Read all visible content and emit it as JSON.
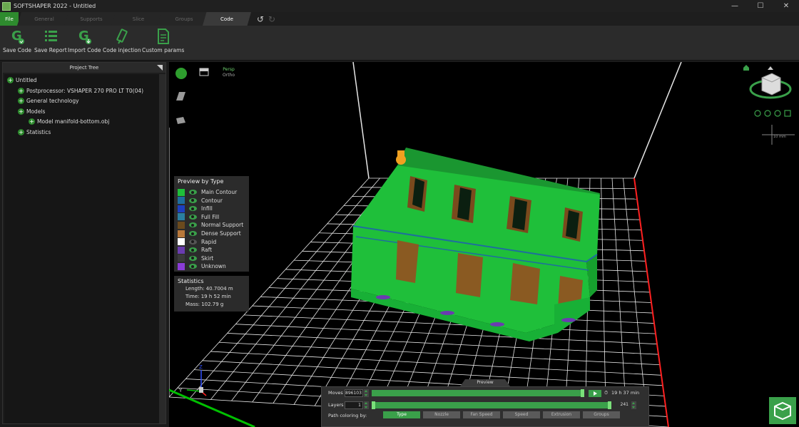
{
  "app": {
    "title": "SOFTSHAPER 2022 - Untitled",
    "window_controls": [
      "—",
      "☐",
      "✕"
    ]
  },
  "tabs": [
    {
      "label": "File",
      "state": "file"
    },
    {
      "label": "General",
      "state": "inactive"
    },
    {
      "label": "Supports",
      "state": "inactive"
    },
    {
      "label": "Slice",
      "state": "inactive"
    },
    {
      "label": "Groups",
      "state": "inactive"
    },
    {
      "label": "Code",
      "state": "active"
    }
  ],
  "toolbar": {
    "save_code": "Save Code",
    "save_report": "Save Report",
    "import_code": "Import Code",
    "code_injection": "Code injection",
    "custom_params": "Custom params"
  },
  "tree": {
    "title": "Project Tree",
    "nodes": [
      {
        "label": "Untitled"
      },
      {
        "label": "Postprocessor: VSHAPER 270 PRO LT T0(04)"
      },
      {
        "label": "General technology"
      },
      {
        "label": "Models"
      },
      {
        "label": "Model manifold-bottom.obj"
      },
      {
        "label": "Statistics"
      }
    ]
  },
  "viewport": {
    "persp": "Persp",
    "ortho": "Ortho",
    "scale_label": "10 mm"
  },
  "legend": {
    "title": "Preview by Type",
    "items": [
      {
        "label": "Main Contour",
        "color": "#1fbf3a",
        "visible": true
      },
      {
        "label": "Contour",
        "color": "#1e6e9e",
        "visible": true
      },
      {
        "label": "Infill",
        "color": "#1d3fc0",
        "visible": true
      },
      {
        "label": "Full Fill",
        "color": "#2a7fa0",
        "visible": true
      },
      {
        "label": "Normal Support",
        "color": "#6b4a1d",
        "visible": true
      },
      {
        "label": "Dense Support",
        "color": "#b8783a",
        "visible": true
      },
      {
        "label": "Rapid",
        "color": "#ffffff",
        "visible": false
      },
      {
        "label": "Raft",
        "color": "#6a3cb0",
        "visible": true
      },
      {
        "label": "Skirt",
        "color": "#3a3a3a",
        "visible": true
      },
      {
        "label": "Unknown",
        "color": "#8a3cd6",
        "visible": true
      }
    ]
  },
  "stats": {
    "title": "Statistics",
    "length": "Length: 40.7004 m",
    "time": "Time: 19 h 52 min",
    "mass": "Mass: 102.79 g"
  },
  "preview": {
    "tab": "Preview",
    "moves_label": "Moves",
    "moves_value": "896103",
    "moves_progress": 1.0,
    "time": "19 h 37 min",
    "layers_label": "Layers",
    "layers_from": "1",
    "layers_to": "241",
    "coloring_label": "Path coloring by:",
    "coloring_options": [
      "Type",
      "Nozzle",
      "Fan Speed",
      "Speed",
      "Extrusion",
      "Groups"
    ],
    "coloring_selected": "Type"
  },
  "colors": {
    "accent": "#3aa04a",
    "main_contour": "#1fbf3a",
    "grid": "#e6e6e6",
    "x_axis": "#ff2020",
    "y_axis": "#00c000"
  }
}
